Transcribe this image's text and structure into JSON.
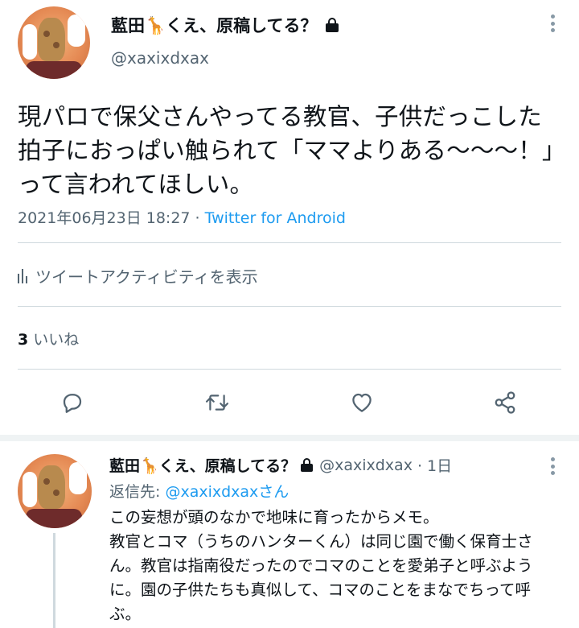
{
  "main_tweet": {
    "display_name": "藍田🦒くえ、原稿してる？",
    "handle": "@xaxixdxax",
    "text": "現パロで保父さんやってる教官、子供だっこした拍子におっぱい触られて「ママよりある〜〜〜！」って言われてほしい。",
    "timestamp": "2021年06月23日 18:27 · ",
    "source": "Twitter for Android",
    "activity_label": "ツイートアクティビティを表示",
    "likes_count": "3",
    "likes_label": "いいね"
  },
  "actions": [
    {
      "icon": "reply-icon"
    },
    {
      "icon": "retweet-icon"
    },
    {
      "icon": "like-icon"
    },
    {
      "icon": "share-icon"
    }
  ],
  "reply_tweet": {
    "display_name": "藍田🦒くえ、原稿してる？",
    "handle": "@xaxixdxax",
    "time": "· 1日",
    "replying_prefix": "返信先: ",
    "replying_to": "@xaxixdxaxさん",
    "text": "この妄想が頭のなかで地味に育ったからメモ。\n教官とコマ（うちのハンターくん）は同じ園で働く保育士さん。教官は指南役だったのでコマのことを愛弟子と呼ぶように。園の子供たちも真似して、コマのことをまなでちって呼ぶ。"
  },
  "colors": {
    "text": "#0f1419",
    "secondary": "#536471",
    "link": "#1d9bf0",
    "divider": "#cfd9de"
  }
}
